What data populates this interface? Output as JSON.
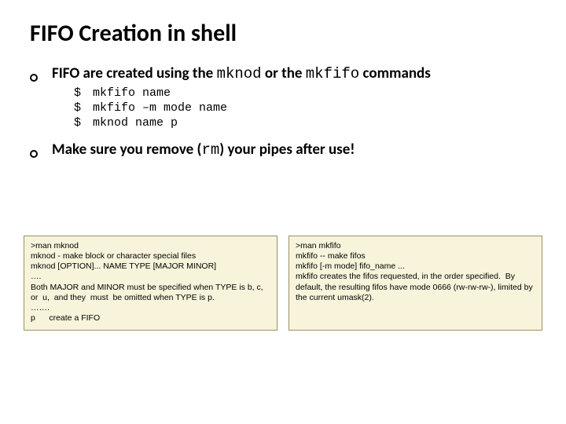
{
  "title": "FIFO Creation in shell",
  "items": [
    {
      "pre": "FIFO are created using the ",
      "code1": "mknod",
      "mid": " or the ",
      "code2": "mkfifo",
      "post": " commands",
      "sub": [
        "mkfifo name",
        "mkfifo –m mode name",
        "mknod name p"
      ]
    },
    {
      "pre": "Make sure you remove (",
      "code1": "rm",
      "mid": "",
      "code2": "",
      "post": ") your pipes after use!"
    }
  ],
  "boxes": [
    ">man mknod\nmknod - make block or character special files\nmknod [OPTION]... NAME TYPE [MAJOR MINOR]\n….\nBoth MAJOR and MINOR must be specified when TYPE is b, c, or  u,  and they  must  be omitted when TYPE is p.\n…….\np      create a FIFO",
    ">man mkfifo\nmkfifo -- make fifos\nmkfifo [-m mode] fifo_name ...\nmkfifo creates the fifos requested, in the order specified.  By default, the resulting fifos have mode 0666 (rw-rw-rw-), limited by the current umask(2)."
  ]
}
